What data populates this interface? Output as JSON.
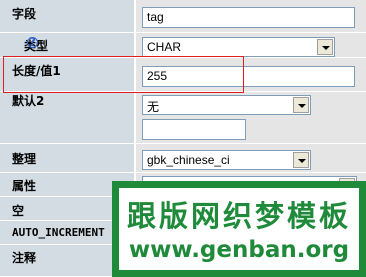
{
  "rows": {
    "field": {
      "label": "字段",
      "value": "tag"
    },
    "type": {
      "label": "类型",
      "help_icon": "help-icon",
      "selected": "CHAR"
    },
    "length": {
      "label": "长度/值1",
      "value": "255"
    },
    "default": {
      "label": "默认2",
      "selected": "无",
      "value": ""
    },
    "collation": {
      "label": "整理",
      "selected": "gbk_chinese_ci"
    },
    "attributes": {
      "label": "属性"
    },
    "null": {
      "label": "空"
    },
    "auto_increment": {
      "label": "AUTO_INCREMENT"
    },
    "comment": {
      "label": "注释"
    }
  },
  "watermark": {
    "chinese": "跟版网织梦模板",
    "url": "www.genban.org"
  },
  "colors": {
    "label_bg": "#d3dce3",
    "value_bg": "#e5e5e5",
    "highlight": "#e02020",
    "watermark": "#1e8a3a"
  }
}
